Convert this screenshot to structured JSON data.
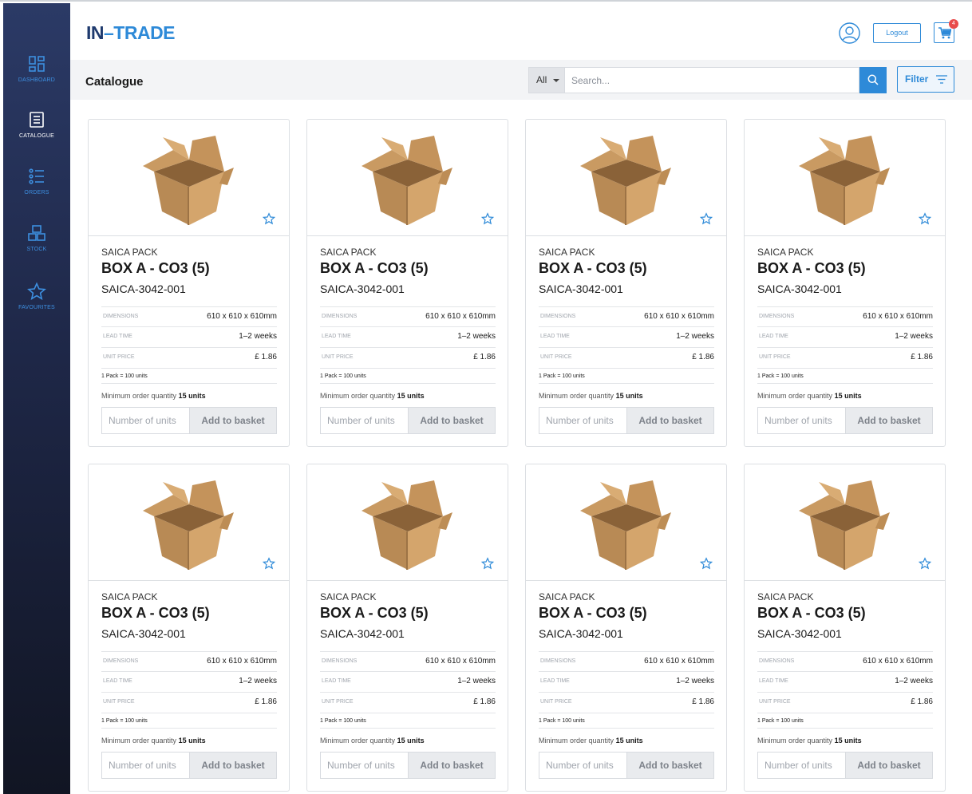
{
  "brand": {
    "logo_left": "IN",
    "logo_dash": "–",
    "logo_right": "TRADE"
  },
  "colors": {
    "accent": "#2e8ad8",
    "navy": "#1f3a6e",
    "badge": "#e84b4b"
  },
  "sidebar": {
    "items": [
      {
        "label": "DASHBOARD",
        "icon": "dashboard-icon",
        "active": false
      },
      {
        "label": "CATALOGUE",
        "icon": "catalogue-icon",
        "active": true
      },
      {
        "label": "ORDERS",
        "icon": "orders-icon",
        "active": false
      },
      {
        "label": "STOCK",
        "icon": "stock-icon",
        "active": false
      },
      {
        "label": "FAVOURITES",
        "icon": "star-icon",
        "active": false
      }
    ]
  },
  "header": {
    "logout_label": "Logout",
    "cart_count": "4",
    "avatar_icon": "user-icon",
    "cart_icon": "cart-icon"
  },
  "toolbar": {
    "title": "Catalogue",
    "scope": "All",
    "search_placeholder": "Search...",
    "filter_label": "Filter"
  },
  "products": [
    {
      "supplier": "SAICA PACK",
      "name": "BOX A - CO3 (5)",
      "sku": "SAICA-3042-001",
      "dimensions_label": "DIMENSIONS",
      "dimensions": "610 x 610 x 610mm",
      "lead_label": "LEAD TIME",
      "lead_time": "1–2 weeks",
      "price_label": "UNIT PRICE",
      "price": "£ 1.86",
      "pack_note": "1 Pack = 100 units",
      "moq_label": "Minimum order quantity",
      "moq_value": "15 units",
      "qty_placeholder": "Number of units",
      "add_label": "Add to basket"
    },
    {
      "supplier": "SAICA PACK",
      "name": "BOX A - CO3 (5)",
      "sku": "SAICA-3042-001",
      "dimensions_label": "DIMENSIONS",
      "dimensions": "610 x 610 x 610mm",
      "lead_label": "LEAD TIME",
      "lead_time": "1–2 weeks",
      "price_label": "UNIT PRICE",
      "price": "£ 1.86",
      "pack_note": "1 Pack = 100 units",
      "moq_label": "Minimum order quantity",
      "moq_value": "15 units",
      "qty_placeholder": "Number of units",
      "add_label": "Add to basket"
    },
    {
      "supplier": "SAICA PACK",
      "name": "BOX A - CO3 (5)",
      "sku": "SAICA-3042-001",
      "dimensions_label": "DIMENSIONS",
      "dimensions": "610 x 610 x 610mm",
      "lead_label": "LEAD TIME",
      "lead_time": "1–2 weeks",
      "price_label": "UNIT PRICE",
      "price": "£ 1.86",
      "pack_note": "1 Pack = 100 units",
      "moq_label": "Minimum order quantity",
      "moq_value": "15 units",
      "qty_placeholder": "Number of units",
      "add_label": "Add to basket"
    },
    {
      "supplier": "SAICA PACK",
      "name": "BOX A - CO3 (5)",
      "sku": "SAICA-3042-001",
      "dimensions_label": "DIMENSIONS",
      "dimensions": "610 x 610 x 610mm",
      "lead_label": "LEAD TIME",
      "lead_time": "1–2 weeks",
      "price_label": "UNIT PRICE",
      "price": "£ 1.86",
      "pack_note": "1 Pack = 100 units",
      "moq_label": "Minimum order quantity",
      "moq_value": "15 units",
      "qty_placeholder": "Number of units",
      "add_label": "Add to basket"
    },
    {
      "supplier": "SAICA PACK",
      "name": "BOX A - CO3 (5)",
      "sku": "SAICA-3042-001",
      "dimensions_label": "DIMENSIONS",
      "dimensions": "610 x 610 x 610mm",
      "lead_label": "LEAD TIME",
      "lead_time": "1–2 weeks",
      "price_label": "UNIT PRICE",
      "price": "£ 1.86",
      "pack_note": "1 Pack = 100 units",
      "moq_label": "Minimum order quantity",
      "moq_value": "15 units",
      "qty_placeholder": "Number of units",
      "add_label": "Add to basket"
    },
    {
      "supplier": "SAICA PACK",
      "name": "BOX A - CO3 (5)",
      "sku": "SAICA-3042-001",
      "dimensions_label": "DIMENSIONS",
      "dimensions": "610 x 610 x 610mm",
      "lead_label": "LEAD TIME",
      "lead_time": "1–2 weeks",
      "price_label": "UNIT PRICE",
      "price": "£ 1.86",
      "pack_note": "1 Pack = 100 units",
      "moq_label": "Minimum order quantity",
      "moq_value": "15 units",
      "qty_placeholder": "Number of units",
      "add_label": "Add to basket"
    },
    {
      "supplier": "SAICA PACK",
      "name": "BOX A - CO3 (5)",
      "sku": "SAICA-3042-001",
      "dimensions_label": "DIMENSIONS",
      "dimensions": "610 x 610 x 610mm",
      "lead_label": "LEAD TIME",
      "lead_time": "1–2 weeks",
      "price_label": "UNIT PRICE",
      "price": "£ 1.86",
      "pack_note": "1 Pack = 100 units",
      "moq_label": "Minimum order quantity",
      "moq_value": "15 units",
      "qty_placeholder": "Number of units",
      "add_label": "Add to basket"
    },
    {
      "supplier": "SAICA PACK",
      "name": "BOX A - CO3 (5)",
      "sku": "SAICA-3042-001",
      "dimensions_label": "DIMENSIONS",
      "dimensions": "610 x 610 x 610mm",
      "lead_label": "LEAD TIME",
      "lead_time": "1–2 weeks",
      "price_label": "UNIT PRICE",
      "price": "£ 1.86",
      "pack_note": "1 Pack = 100 units",
      "moq_label": "Minimum order quantity",
      "moq_value": "15 units",
      "qty_placeholder": "Number of units",
      "add_label": "Add to basket"
    }
  ]
}
